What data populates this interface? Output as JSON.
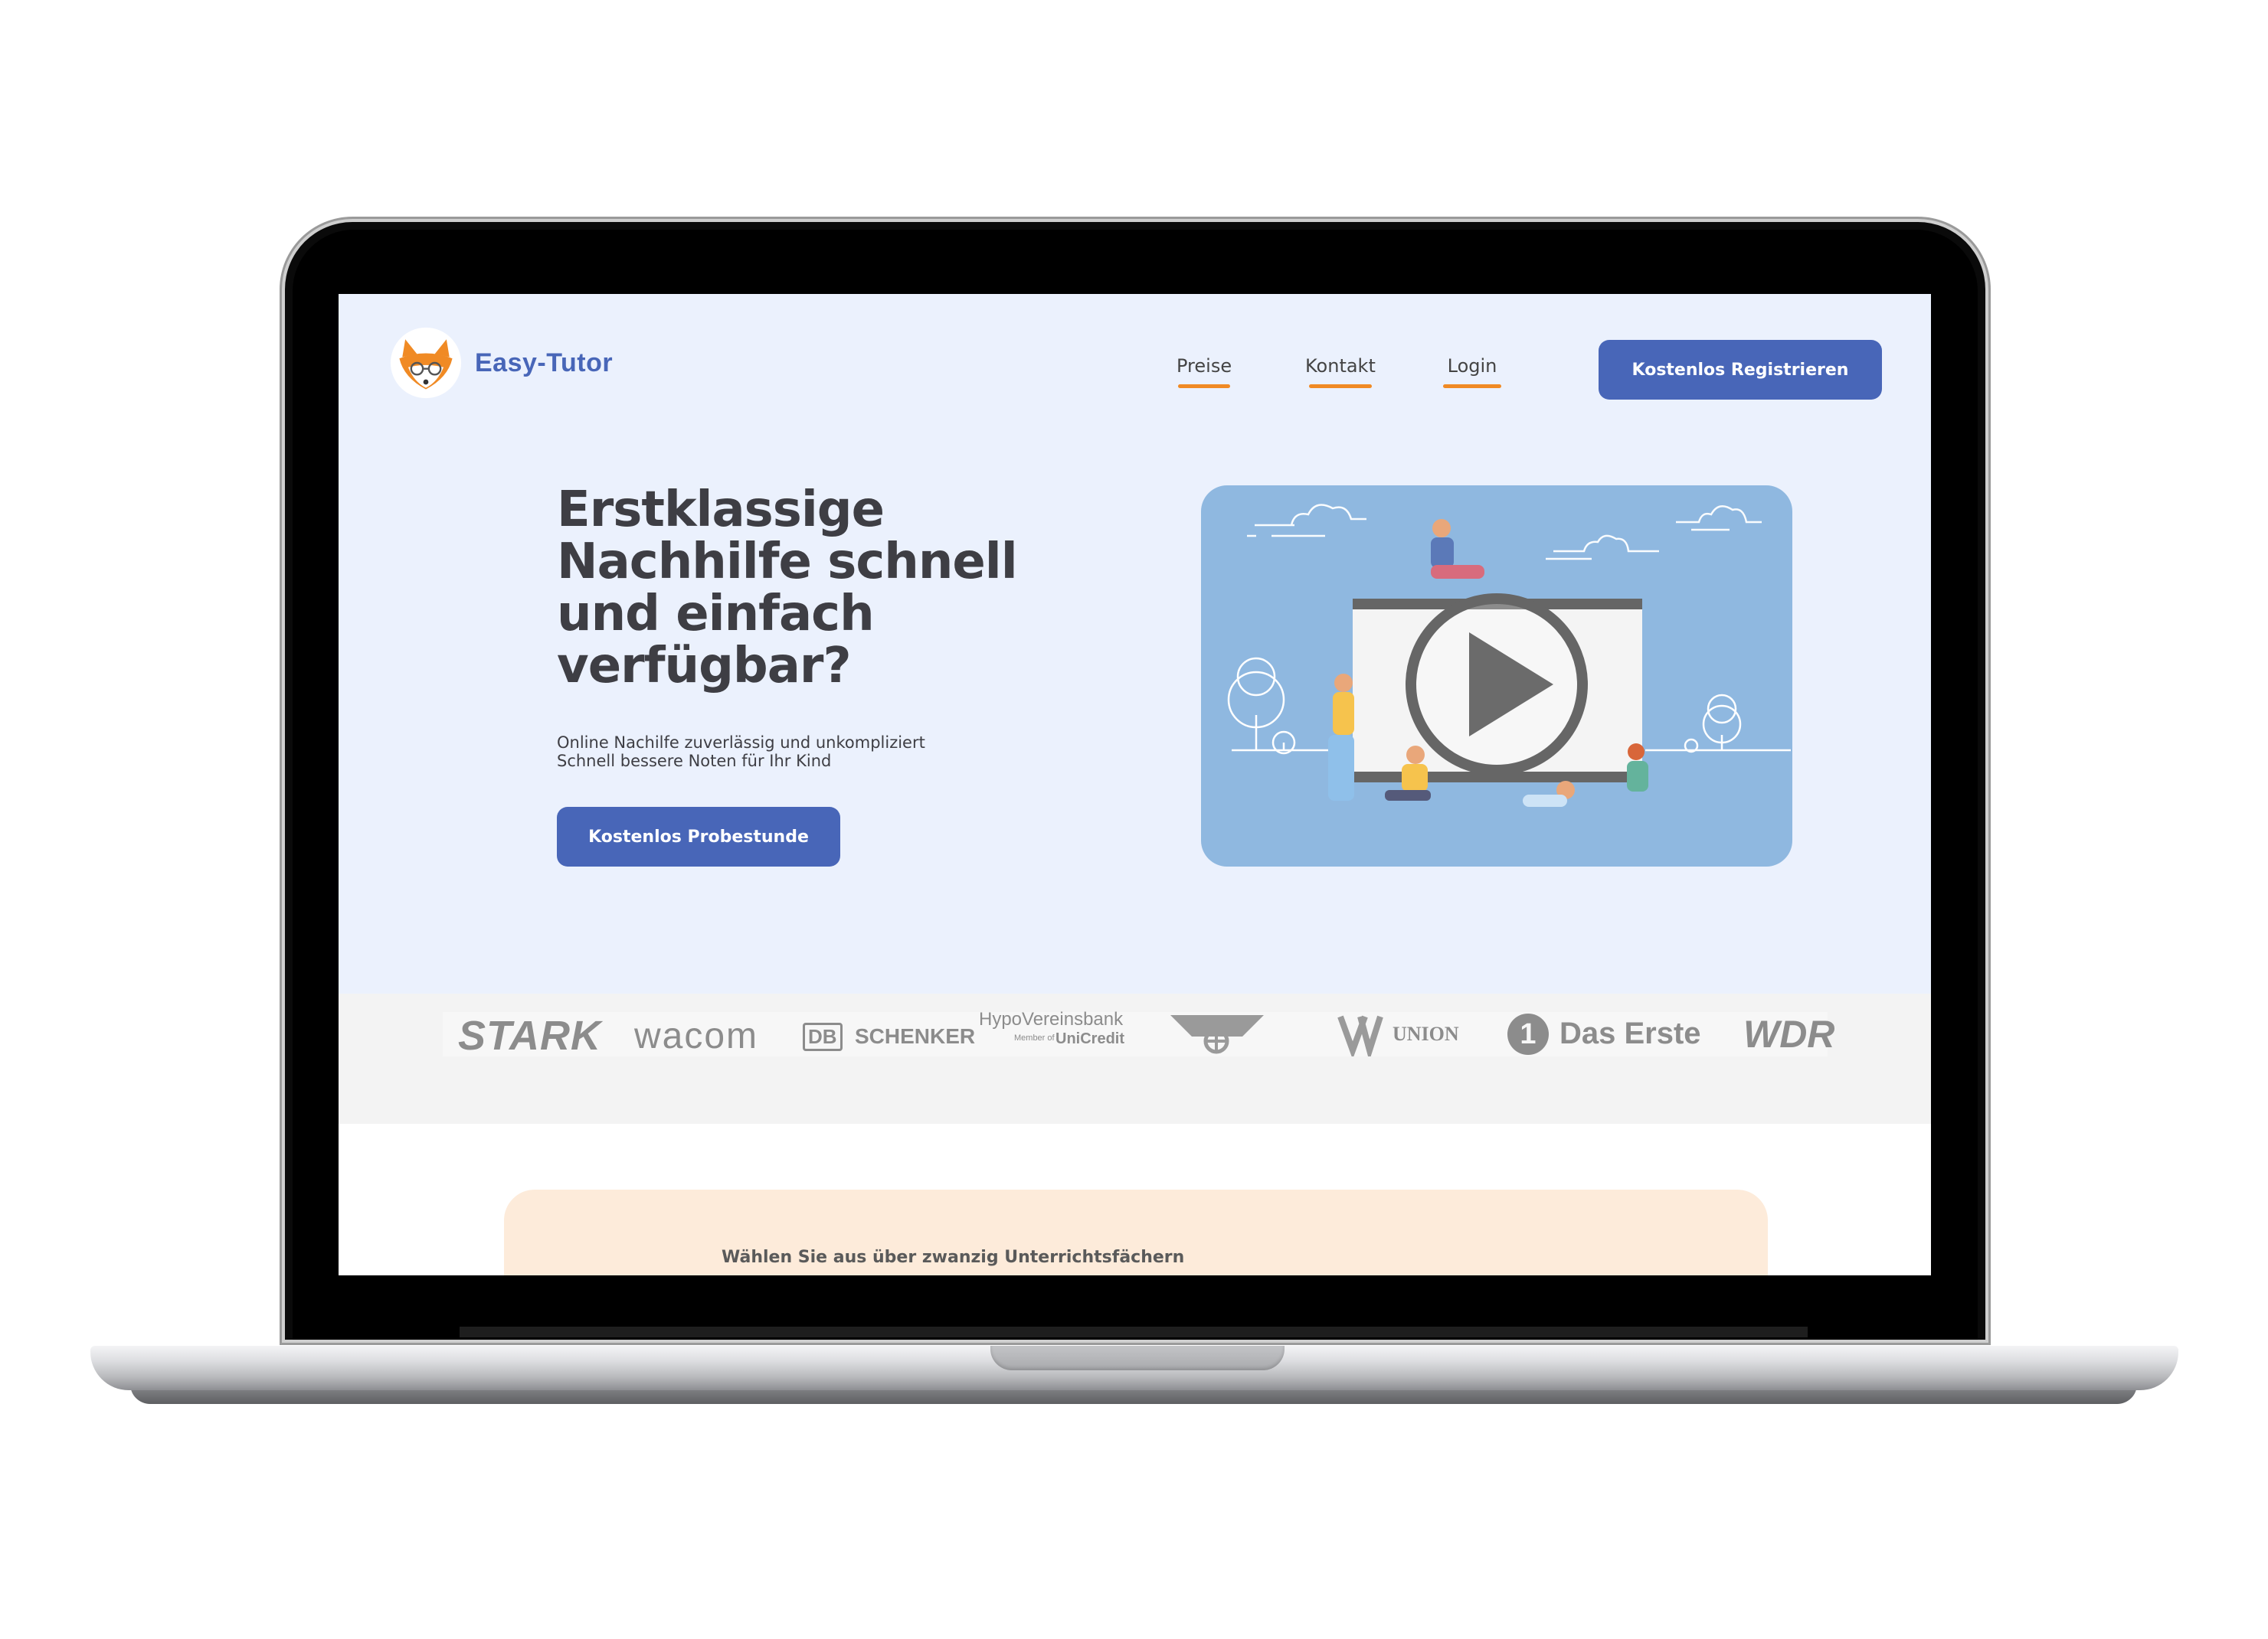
{
  "site": {
    "brand": "Easy-Tutor",
    "nav": [
      {
        "label": "Preise"
      },
      {
        "label": "Kontakt"
      },
      {
        "label": "Login"
      }
    ],
    "register_button": "Kostenlos Registrieren"
  },
  "hero": {
    "headline": "Erstklassige Nachhilfe schnell und einfach verfügbar?",
    "subline_1": "Online Nachilfe zuverlässig und unkompliziert",
    "subline_2": "Schnell bessere Noten für Ihr Kind",
    "cta_button": "Kostenlos Probestunde",
    "video_icon": "play-icon"
  },
  "partners": {
    "stark": "STARK",
    "wacom": "wacom",
    "db": "DB",
    "schenker": "SCHENKER",
    "hypo": "HypoVereinsbank",
    "hypo_sub": "Member of",
    "unicredit": "UniCredit",
    "union": "UNION",
    "das_erste": "Das Erste",
    "wdr": "WDR",
    "one": "1"
  },
  "subjects": {
    "title": "Wählen Sie aus über zwanzig Unterrichtsfächern"
  },
  "colors": {
    "accent": "#4866b8",
    "underline": "#f08a24",
    "hero_bg": "#ebf1fd",
    "video_bg": "#8fb8e0",
    "card_bg": "#fdebda"
  }
}
